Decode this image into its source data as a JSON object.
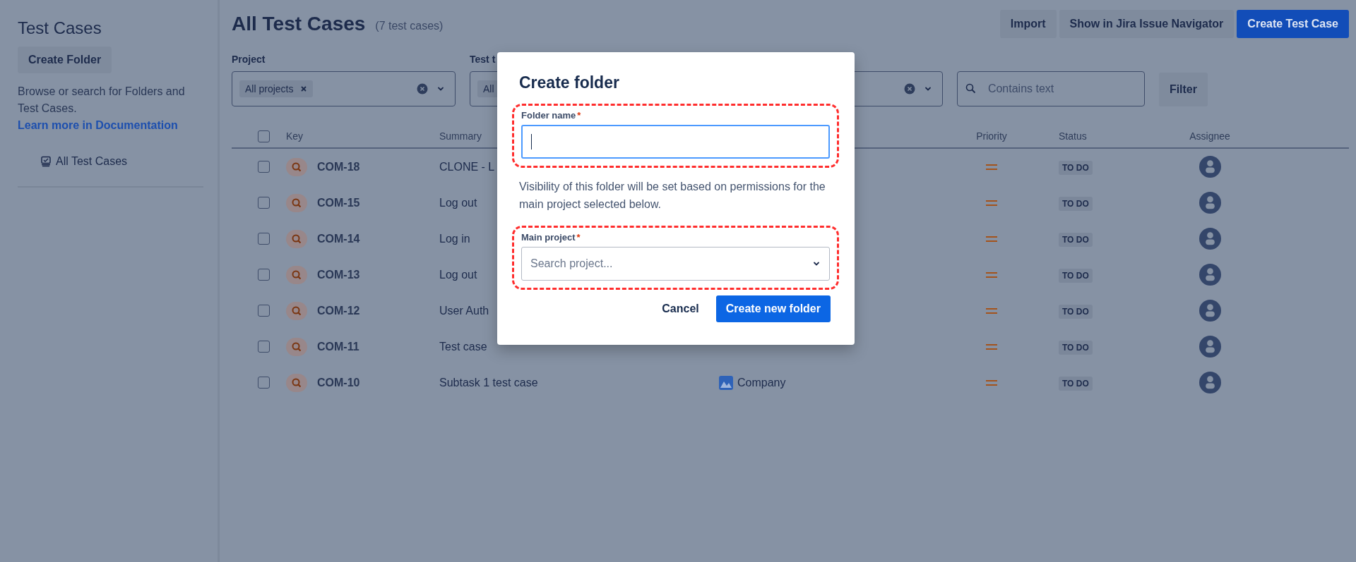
{
  "sidebar": {
    "title": "Test Cases",
    "create_button": "Create Folder",
    "description": "Browse or search for Folders and Test Cases.",
    "link": "Learn more in Documentation",
    "items": [
      {
        "label": "All Test Cases"
      }
    ]
  },
  "header": {
    "title": "All Test Cases",
    "count": "(7 test cases)",
    "buttons": [
      {
        "label": "Import",
        "kind": "secondary"
      },
      {
        "label": "Show in Jira Issue Navigator",
        "kind": "secondary"
      },
      {
        "label": "Create Test Case",
        "kind": "primary"
      }
    ]
  },
  "filters": [
    {
      "label": "Project",
      "chip": "All projects",
      "clearable": true,
      "kind": "select"
    },
    {
      "label": "Test t",
      "chip": "All",
      "kind": "select"
    },
    {
      "clearable": true,
      "kind": "select"
    },
    {
      "placeholder": "Contains text",
      "kind": "search"
    }
  ],
  "filter_button": "Filter",
  "table": {
    "all_checked": false,
    "columns": [
      "Key",
      "Summary",
      "Priority",
      "Status",
      "Assignee"
    ],
    "rows": [
      {
        "checked": false,
        "key": "COM-18",
        "summary": "CLONE - L",
        "status": "TO DO"
      },
      {
        "checked": false,
        "key": "COM-15",
        "summary": "Log out",
        "status": "TO DO"
      },
      {
        "checked": false,
        "key": "COM-14",
        "summary": "Log in",
        "status": "TO DO"
      },
      {
        "checked": false,
        "key": "COM-13",
        "summary": "Log out",
        "status": "TO DO"
      },
      {
        "checked": false,
        "key": "COM-12",
        "summary": "User Auth",
        "status": "TO DO"
      },
      {
        "checked": false,
        "key": "COM-11",
        "summary": "Test case",
        "status": "TO DO"
      },
      {
        "checked": false,
        "key": "COM-10",
        "summary": "Subtask 1 test case",
        "project": "Company",
        "status": "TO DO"
      }
    ]
  },
  "dialog": {
    "title": "Create folder",
    "fields": [
      {
        "label": "Folder name",
        "required_mark": "*",
        "kind": "text",
        "focused": true,
        "highlighted": true
      },
      {
        "label": "Main project",
        "required_mark": "*",
        "kind": "select",
        "placeholder": "Search project...",
        "focused": false,
        "highlighted": true
      }
    ],
    "note": "Visibility of this folder will be set based on permissions for the main project selected below.",
    "buttons": [
      {
        "label": "Cancel",
        "kind": "subtle"
      },
      {
        "label": "Create new folder",
        "kind": "primary"
      }
    ]
  }
}
